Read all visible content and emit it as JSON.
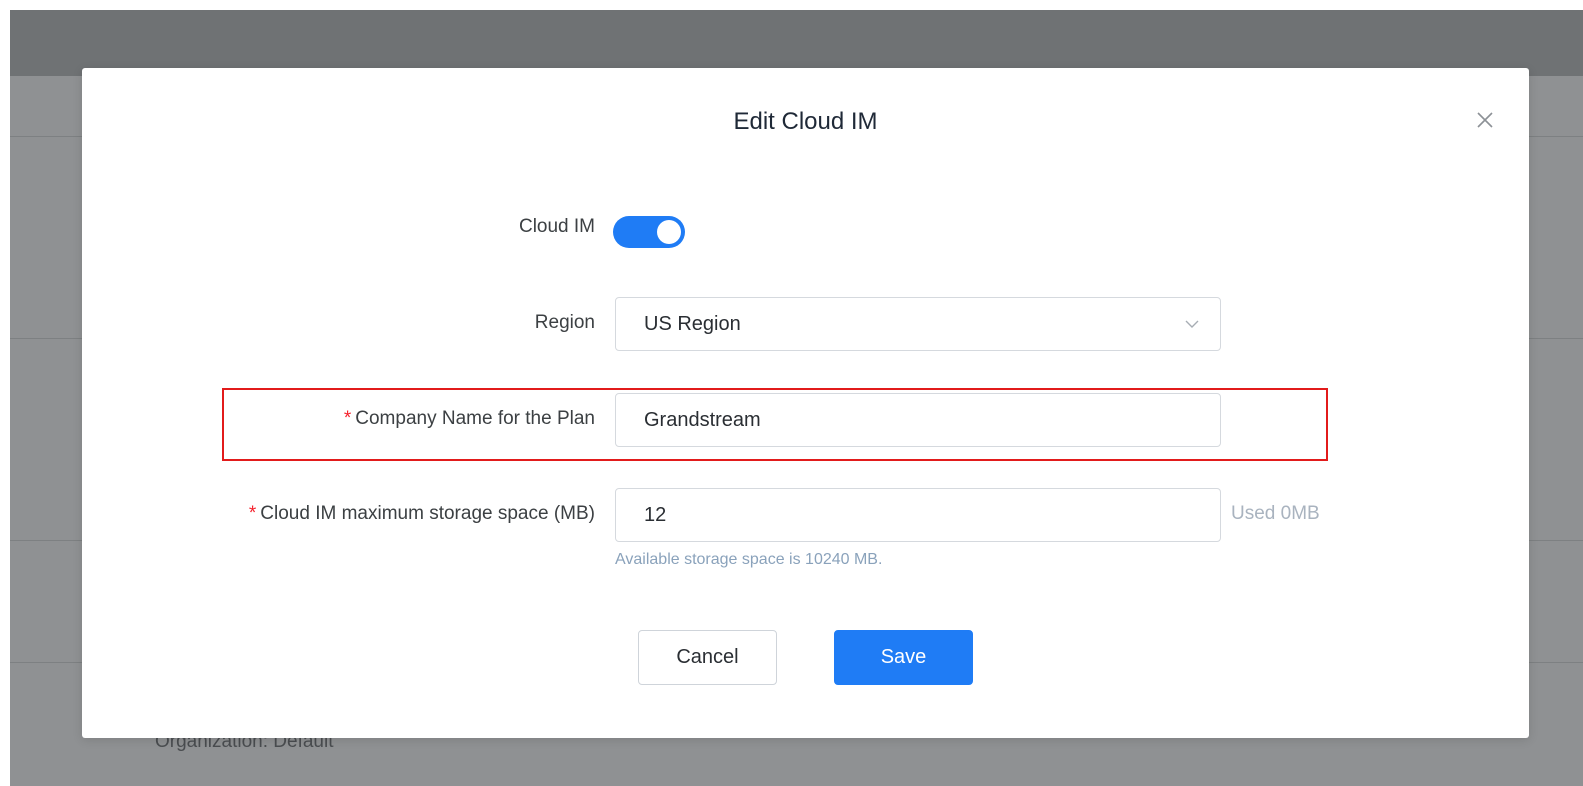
{
  "background": {
    "organization_text": "Organization: Default"
  },
  "modal": {
    "title": "Edit Cloud IM",
    "close_icon": "close-icon"
  },
  "form": {
    "cloud_im": {
      "label": "Cloud IM",
      "enabled": true
    },
    "region": {
      "label": "Region",
      "value": "US Region",
      "icon": "chevron-down-icon"
    },
    "company_name": {
      "required_mark": "*",
      "label": "Company Name for the Plan",
      "value": "Grandstream"
    },
    "storage": {
      "required_mark": "*",
      "label": "Cloud IM maximum storage space (MB)",
      "value": "12",
      "suffix": "Used 0MB",
      "hint": "Available storage space is 10240 MB."
    }
  },
  "actions": {
    "cancel_label": "Cancel",
    "save_label": "Save"
  },
  "colors": {
    "primary": "#1f7cf5",
    "required": "#f5222d",
    "highlight": "#e21b1b",
    "overlay": "#8f9193"
  }
}
